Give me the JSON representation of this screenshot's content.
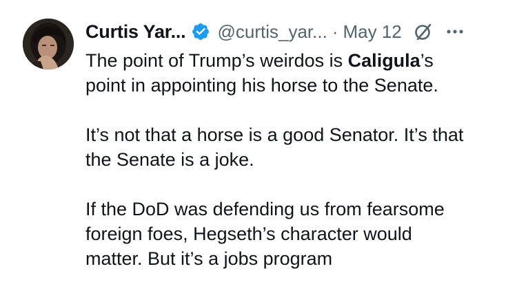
{
  "author": {
    "display_name": "Curtis Yar...",
    "handle": "@curtis_yar...",
    "separator": "·",
    "date": "May 12"
  },
  "icons": {
    "verified": "verified-badge-icon",
    "grok": "grok-icon",
    "more": "more-options-icon"
  },
  "colors": {
    "verified_blue": "#1d9bf0",
    "text_primary": "#0f1419",
    "text_secondary": "#536471"
  },
  "tweet": {
    "p1_a": "The point of Trump’s weirdos is ",
    "p1_bold": "Caligula",
    "p1_b": "’s",
    "p1_c": "point in appointing his horse to the Senate.",
    "p2_a": "It’s not that a horse is a good Senator. It’s that",
    "p2_b": "the Senate is a joke.",
    "p3_a": "If the DoD was defending us from fearsome",
    "p3_b": "foreign foes, Hegseth’s character would",
    "p3_c": "matter. But it’s a jobs program"
  }
}
